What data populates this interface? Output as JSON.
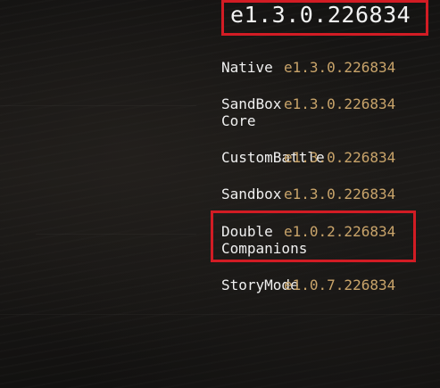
{
  "game_version": "e1.3.0.226834",
  "mods": [
    {
      "name_line1": "Native",
      "name_line2": "",
      "version": "e1.3.0.226834"
    },
    {
      "name_line1": "SandBox",
      "name_line2": "Core",
      "version": "e1.3.0.226834"
    },
    {
      "name_line1": "CustomBattle",
      "name_line2": "",
      "version": "e1.3.0.226834"
    },
    {
      "name_line1": "Sandbox",
      "name_line2": "",
      "version": "e1.3.0.226834"
    },
    {
      "name_line1": "Double",
      "name_line2": "Companions",
      "version": "e1.0.2.226834"
    },
    {
      "name_line1": "StoryMode",
      "name_line2": "",
      "version": "e1.0.7.226834"
    }
  ],
  "colors": {
    "highlight_border": "#d21c24",
    "version_text": "#c9a46a",
    "name_text": "#f0f0f0"
  }
}
